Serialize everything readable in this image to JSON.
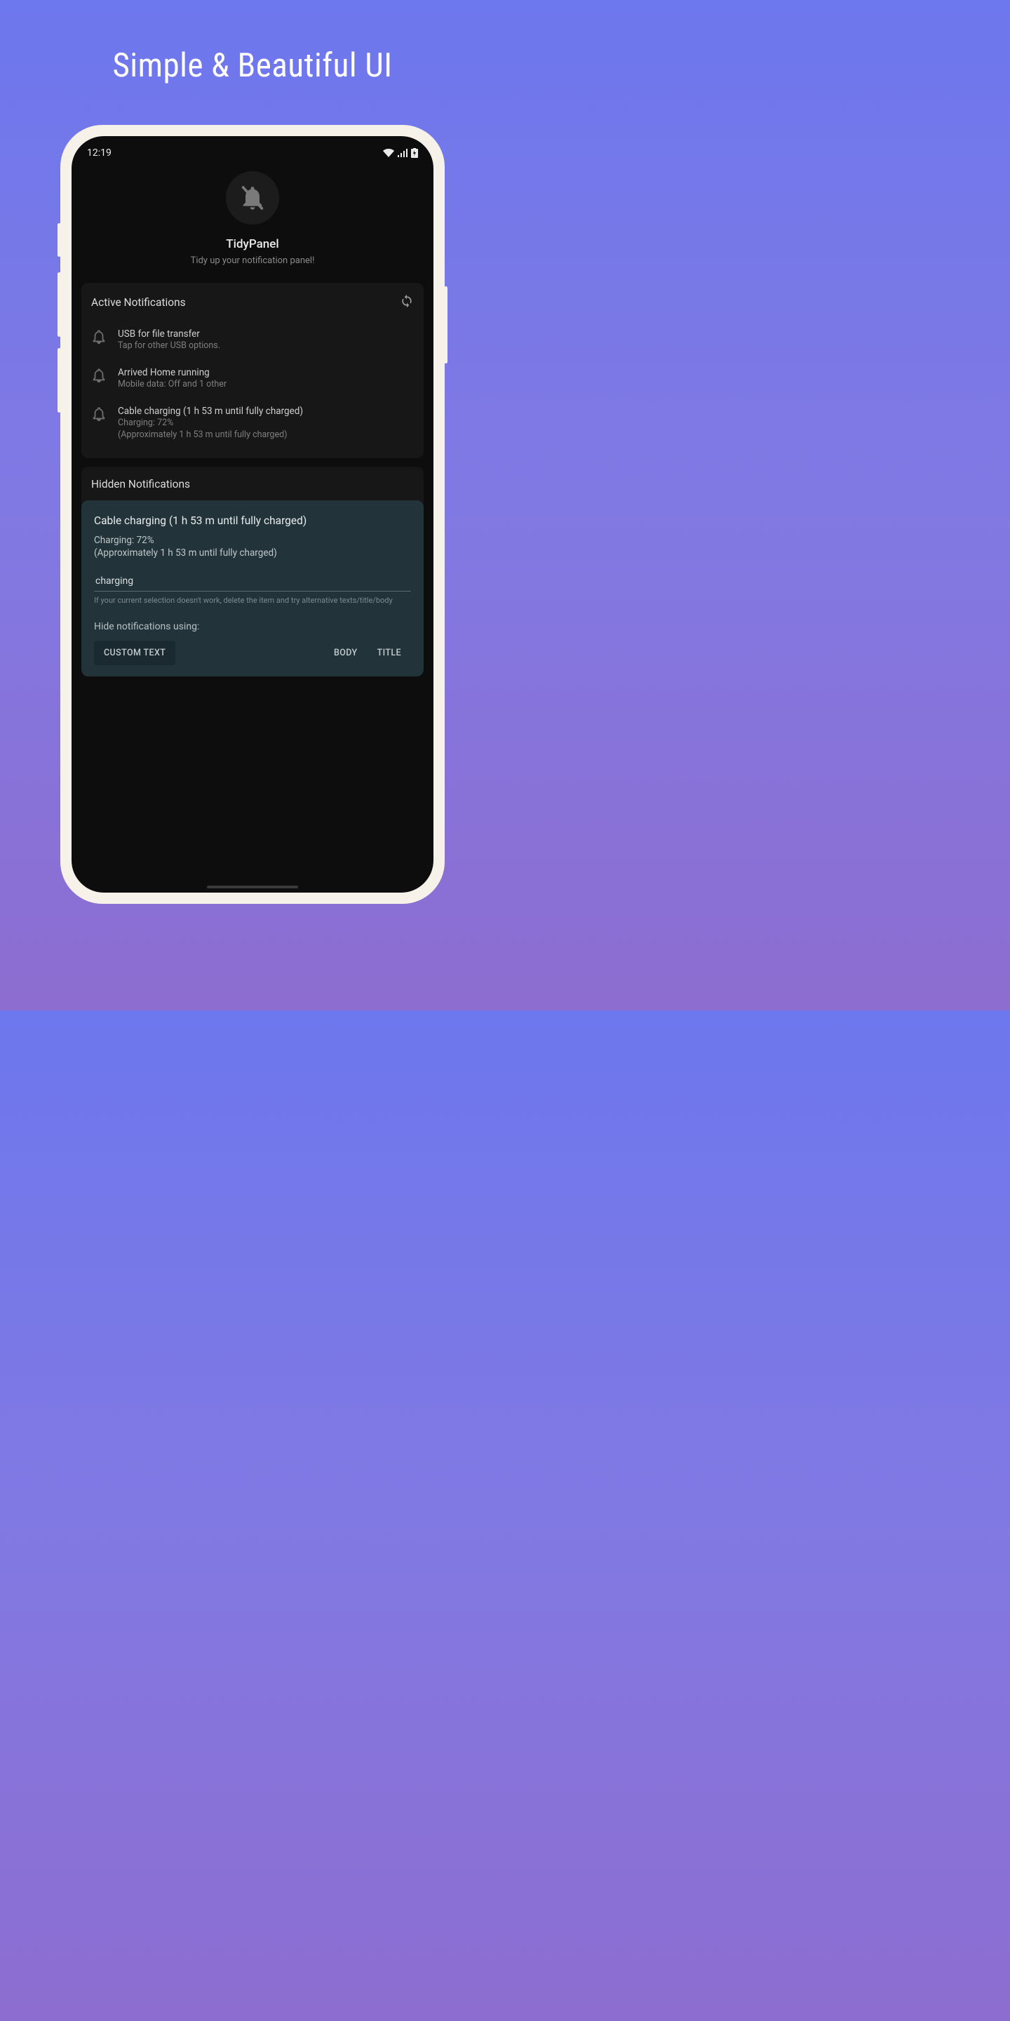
{
  "headline": "Simple & Beautiful UI",
  "status": {
    "time": "12:19"
  },
  "app": {
    "title": "TidyPanel",
    "subtitle": "Tidy up your notification panel!"
  },
  "active": {
    "header": "Active Notifications",
    "items": [
      {
        "title": "USB for file transfer",
        "sub1": "Tap for other USB options.",
        "sub2": ""
      },
      {
        "title": "Arrived Home running",
        "sub1": "Mobile data: Off and 1 other",
        "sub2": ""
      },
      {
        "title": "Cable charging (1 h 53 m until fully charged)",
        "sub1": "Charging: 72%",
        "sub2": "(Approximately 1 h 53 m until fully charged)"
      }
    ]
  },
  "hidden": {
    "header": "Hidden Notifications",
    "detail": {
      "title": "Cable charging (1 h 53 m until fully charged)",
      "body1": "Charging: 72%",
      "body2": "(Approximately 1 h 53 m until fully charged)",
      "input_value": "charging",
      "hint": "If your current selection doesn't work, delete the item and try alternative texts/title/body",
      "hide_label": "Hide notifications using:",
      "buttons": {
        "custom": "CUSTOM TEXT",
        "body": "BODY",
        "title": "TITLE"
      }
    }
  }
}
